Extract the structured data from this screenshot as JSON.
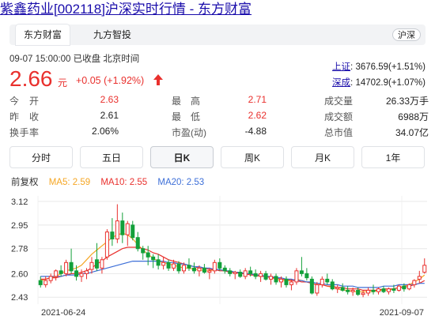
{
  "page": {
    "title": "紫鑫药业[002118]沪深实时行情 - 东方财富"
  },
  "tabs": [
    {
      "label": "东方财富",
      "active": true
    },
    {
      "label": "九方智投",
      "active": false
    }
  ],
  "region_badge": "沪深",
  "quote": {
    "datetime": "09-07 15:00:00",
    "status": "已收盘",
    "timezone": "北京时间",
    "price": "2.66",
    "unit": "元",
    "change": "+0.05",
    "change_pct": "(+1.92%)",
    "direction": "up",
    "up_color": "#e9302d"
  },
  "indices": [
    {
      "name": "上证",
      "value": "3676.59(+1.51%)"
    },
    {
      "name": "深成",
      "value": "14702.9(+1.07%)"
    }
  ],
  "stats": [
    {
      "l1": "今　开",
      "v1": "2.63",
      "l2": "最　高",
      "v2": "2.71",
      "l3": "成交量",
      "v3": "26.33万手"
    },
    {
      "l1": "昨　收",
      "v1": "2.61",
      "l2": "最　低",
      "v2": "2.62",
      "l3": "成交额",
      "v3": "6988万"
    },
    {
      "l1": "换手率",
      "v1": "2.06%",
      "l2": "市盈(动)",
      "v2": "-4.88",
      "l3": "总市值",
      "v3": "34.07亿"
    }
  ],
  "periods": [
    {
      "label": "分时",
      "selected": false
    },
    {
      "label": "五日",
      "selected": false
    },
    {
      "label": "日K",
      "selected": true
    },
    {
      "label": "周K",
      "selected": false
    },
    {
      "label": "月K",
      "selected": false
    },
    {
      "label": "1年",
      "selected": false
    }
  ],
  "ma_legend": {
    "adjust": "前复权",
    "ma5": "MA5: 2.59",
    "ma10": "MA10: 2.55",
    "ma20": "MA20: 2.53"
  },
  "colors": {
    "ma5": "#f5a623",
    "ma10": "#e9302d",
    "ma20": "#3d6fd8",
    "candle_up": "#e9302d",
    "candle_down": "#13a03a"
  },
  "chart_data": {
    "type": "candlestick",
    "ytick_labels": [
      "3.12",
      "2.95",
      "2.78",
      "2.60",
      "2.43"
    ],
    "ylim": [
      2.38,
      3.16
    ],
    "x_labels": [
      "2021-06-24",
      "2021-09-07"
    ],
    "series": [
      {
        "name": "日K",
        "values": [
          [
            2.55,
            2.58,
            2.5,
            2.52
          ],
          [
            2.52,
            2.58,
            2.5,
            2.55
          ],
          [
            2.55,
            2.6,
            2.53,
            2.58
          ],
          [
            2.58,
            2.63,
            2.55,
            2.62
          ],
          [
            2.62,
            2.66,
            2.58,
            2.6
          ],
          [
            2.6,
            2.7,
            2.58,
            2.68
          ],
          [
            2.68,
            2.78,
            2.6,
            2.62
          ],
          [
            2.62,
            2.66,
            2.55,
            2.58
          ],
          [
            2.58,
            2.63,
            2.54,
            2.6
          ],
          [
            2.6,
            2.64,
            2.56,
            2.62
          ],
          [
            2.63,
            2.72,
            2.6,
            2.68
          ],
          [
            2.7,
            2.82,
            2.62,
            2.64
          ],
          [
            2.64,
            2.72,
            2.6,
            2.7
          ],
          [
            2.72,
            2.92,
            2.7,
            2.9
          ],
          [
            2.9,
            3.0,
            2.8,
            2.85
          ],
          [
            2.85,
            3.1,
            2.82,
            2.98
          ],
          [
            2.98,
            3.04,
            2.82,
            2.88
          ],
          [
            2.88,
            2.98,
            2.8,
            2.96
          ],
          [
            2.95,
            2.98,
            2.84,
            2.86
          ],
          [
            2.86,
            2.9,
            2.76,
            2.78
          ],
          [
            2.78,
            2.8,
            2.7,
            2.75
          ],
          [
            2.75,
            2.8,
            2.66,
            2.72
          ],
          [
            2.72,
            2.74,
            2.64,
            2.7
          ],
          [
            2.7,
            2.74,
            2.63,
            2.66
          ],
          [
            2.66,
            2.72,
            2.63,
            2.68
          ],
          [
            2.68,
            2.7,
            2.62,
            2.64
          ],
          [
            2.64,
            2.7,
            2.62,
            2.67
          ],
          [
            2.67,
            2.69,
            2.6,
            2.62
          ],
          [
            2.62,
            2.68,
            2.6,
            2.66
          ],
          [
            2.66,
            2.71,
            2.62,
            2.64
          ],
          [
            2.64,
            2.68,
            2.6,
            2.62
          ],
          [
            2.62,
            2.66,
            2.58,
            2.64
          ],
          [
            2.64,
            2.67,
            2.6,
            2.61
          ],
          [
            2.61,
            2.64,
            2.56,
            2.62
          ],
          [
            2.62,
            2.7,
            2.6,
            2.68
          ],
          [
            2.68,
            2.71,
            2.62,
            2.64
          ],
          [
            2.64,
            2.66,
            2.6,
            2.62
          ],
          [
            2.62,
            2.64,
            2.58,
            2.6
          ],
          [
            2.6,
            2.62,
            2.56,
            2.61
          ],
          [
            2.61,
            2.63,
            2.57,
            2.58
          ],
          [
            2.58,
            2.64,
            2.56,
            2.62
          ],
          [
            2.62,
            2.65,
            2.58,
            2.6
          ],
          [
            2.6,
            2.63,
            2.56,
            2.58
          ],
          [
            2.58,
            2.62,
            2.54,
            2.6
          ],
          [
            2.6,
            2.62,
            2.55,
            2.56
          ],
          [
            2.56,
            2.6,
            2.52,
            2.58
          ],
          [
            2.58,
            2.6,
            2.52,
            2.54
          ],
          [
            2.54,
            2.58,
            2.5,
            2.56
          ],
          [
            2.56,
            2.58,
            2.5,
            2.52
          ],
          [
            2.52,
            2.56,
            2.48,
            2.54
          ],
          [
            2.54,
            2.64,
            2.52,
            2.62
          ],
          [
            2.62,
            2.72,
            2.58,
            2.6
          ],
          [
            2.6,
            2.64,
            2.55,
            2.57
          ],
          [
            2.56,
            2.58,
            2.45,
            2.46
          ],
          [
            2.46,
            2.54,
            2.44,
            2.52
          ],
          [
            2.52,
            2.58,
            2.5,
            2.56
          ],
          [
            2.56,
            2.6,
            2.52,
            2.54
          ],
          [
            2.54,
            2.56,
            2.48,
            2.49
          ],
          [
            2.49,
            2.52,
            2.46,
            2.5
          ],
          [
            2.5,
            2.53,
            2.47,
            2.48
          ],
          [
            2.48,
            2.51,
            2.45,
            2.47
          ],
          [
            2.47,
            2.5,
            2.44,
            2.48
          ],
          [
            2.48,
            2.5,
            2.44,
            2.45
          ],
          [
            2.45,
            2.48,
            2.43,
            2.46
          ],
          [
            2.46,
            2.5,
            2.44,
            2.48
          ],
          [
            2.48,
            2.52,
            2.45,
            2.47
          ],
          [
            2.47,
            2.5,
            2.45,
            2.49
          ],
          [
            2.49,
            2.51,
            2.46,
            2.47
          ],
          [
            2.47,
            2.5,
            2.45,
            2.49
          ],
          [
            2.49,
            2.52,
            2.46,
            2.48
          ],
          [
            2.48,
            2.52,
            2.47,
            2.51
          ],
          [
            2.51,
            2.53,
            2.47,
            2.49
          ],
          [
            2.49,
            2.53,
            2.48,
            2.52
          ],
          [
            2.52,
            2.56,
            2.5,
            2.55
          ],
          [
            2.56,
            2.62,
            2.53,
            2.58
          ],
          [
            2.61,
            2.71,
            2.6,
            2.66
          ]
        ]
      },
      {
        "name": "MA5",
        "values": [
          2.55,
          2.56,
          2.57,
          2.58,
          2.6,
          2.62,
          2.63,
          2.64,
          2.66,
          2.7,
          2.74,
          2.77,
          2.8,
          2.83,
          2.86,
          2.88,
          2.89,
          2.88,
          2.85,
          2.81,
          2.77,
          2.74,
          2.71,
          2.69,
          2.68,
          2.67,
          2.66,
          2.65,
          2.64,
          2.64,
          2.63,
          2.63,
          2.62,
          2.62,
          2.63,
          2.63,
          2.62,
          2.61,
          2.61,
          2.61,
          2.6,
          2.6,
          2.59,
          2.58,
          2.58,
          2.57,
          2.56,
          2.55,
          2.55,
          2.55,
          2.56,
          2.55,
          2.54,
          2.53,
          2.52,
          2.52,
          2.51,
          2.5,
          2.49,
          2.48,
          2.48,
          2.47,
          2.47,
          2.47,
          2.47,
          2.47,
          2.48,
          2.48,
          2.48,
          2.49,
          2.5,
          2.51,
          2.52,
          2.54,
          2.56,
          2.59
        ]
      },
      {
        "name": "MA10",
        "values": [
          2.56,
          2.56,
          2.57,
          2.57,
          2.58,
          2.59,
          2.6,
          2.6,
          2.61,
          2.62,
          2.64,
          2.67,
          2.69,
          2.72,
          2.74,
          2.76,
          2.78,
          2.79,
          2.79,
          2.79,
          2.78,
          2.77,
          2.75,
          2.74,
          2.72,
          2.7,
          2.69,
          2.68,
          2.67,
          2.66,
          2.65,
          2.64,
          2.64,
          2.63,
          2.63,
          2.62,
          2.62,
          2.61,
          2.61,
          2.6,
          2.6,
          2.59,
          2.59,
          2.58,
          2.58,
          2.57,
          2.57,
          2.56,
          2.56,
          2.55,
          2.55,
          2.54,
          2.54,
          2.53,
          2.52,
          2.52,
          2.51,
          2.51,
          2.5,
          2.5,
          2.49,
          2.49,
          2.49,
          2.48,
          2.48,
          2.48,
          2.48,
          2.49,
          2.49,
          2.49,
          2.5,
          2.5,
          2.51,
          2.52,
          2.53,
          2.55
        ]
      },
      {
        "name": "MA20",
        "values": [
          2.58,
          2.58,
          2.58,
          2.58,
          2.58,
          2.59,
          2.59,
          2.59,
          2.6,
          2.6,
          2.61,
          2.62,
          2.63,
          2.64,
          2.65,
          2.66,
          2.67,
          2.68,
          2.69,
          2.69,
          2.69,
          2.69,
          2.69,
          2.69,
          2.69,
          2.68,
          2.68,
          2.67,
          2.67,
          2.66,
          2.65,
          2.65,
          2.64,
          2.64,
          2.63,
          2.63,
          2.62,
          2.62,
          2.61,
          2.61,
          2.6,
          2.6,
          2.59,
          2.59,
          2.58,
          2.58,
          2.57,
          2.57,
          2.56,
          2.56,
          2.55,
          2.55,
          2.54,
          2.54,
          2.53,
          2.53,
          2.52,
          2.52,
          2.52,
          2.51,
          2.51,
          2.51,
          2.5,
          2.5,
          2.5,
          2.5,
          2.5,
          2.51,
          2.51,
          2.51,
          2.52,
          2.52,
          2.52,
          2.52,
          2.53,
          2.53
        ]
      }
    ]
  }
}
